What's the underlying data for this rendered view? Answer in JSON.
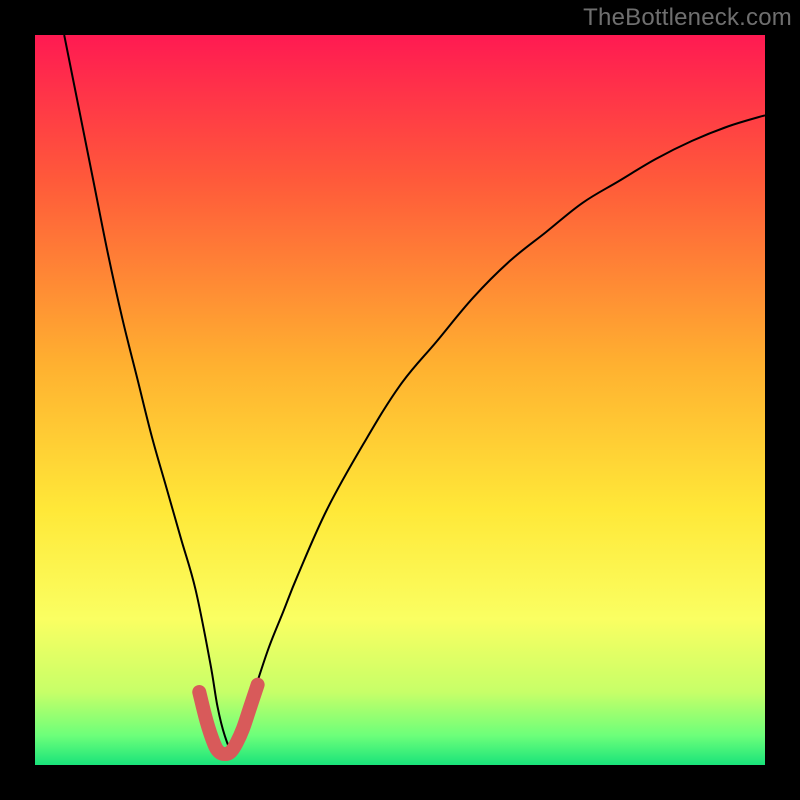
{
  "watermark": "TheBottleneck.com",
  "chart_data": {
    "type": "line",
    "title": "",
    "xlabel": "",
    "ylabel": "",
    "xlim": [
      0,
      100
    ],
    "ylim": [
      0,
      100
    ],
    "grid": false,
    "legend": false,
    "annotations": [],
    "gradient_stops": [
      {
        "offset": 0.0,
        "color": "#ff1a52"
      },
      {
        "offset": 0.2,
        "color": "#ff5a3a"
      },
      {
        "offset": 0.45,
        "color": "#ffb030"
      },
      {
        "offset": 0.65,
        "color": "#ffe838"
      },
      {
        "offset": 0.8,
        "color": "#faff62"
      },
      {
        "offset": 0.9,
        "color": "#c7ff68"
      },
      {
        "offset": 0.96,
        "color": "#6cff7a"
      },
      {
        "offset": 1.0,
        "color": "#19e37a"
      }
    ],
    "series": [
      {
        "name": "bottleneck-curve",
        "stroke": "#000000",
        "stroke_width": 2,
        "x": [
          4,
          6,
          8,
          10,
          12,
          14,
          16,
          18,
          20,
          22,
          24,
          25,
          26,
          27,
          28,
          30,
          32,
          34,
          36,
          40,
          45,
          50,
          55,
          60,
          65,
          70,
          75,
          80,
          85,
          90,
          95,
          100
        ],
        "values": [
          100,
          90,
          80,
          70,
          61,
          53,
          45,
          38,
          31,
          24,
          14,
          8,
          4,
          2,
          4,
          10,
          16,
          21,
          26,
          35,
          44,
          52,
          58,
          64,
          69,
          73,
          77,
          80,
          83,
          85.5,
          87.5,
          89
        ]
      },
      {
        "name": "low-bottleneck-highlight",
        "stroke": "#d85a5a",
        "stroke_width": 14,
        "linecap": "round",
        "x": [
          22.5,
          23.5,
          24.5,
          25.2,
          26.0,
          26.8,
          27.6,
          28.5,
          29.5,
          30.5
        ],
        "values": [
          10,
          6,
          3,
          1.8,
          1.5,
          1.8,
          3,
          5,
          8,
          11
        ]
      }
    ]
  }
}
